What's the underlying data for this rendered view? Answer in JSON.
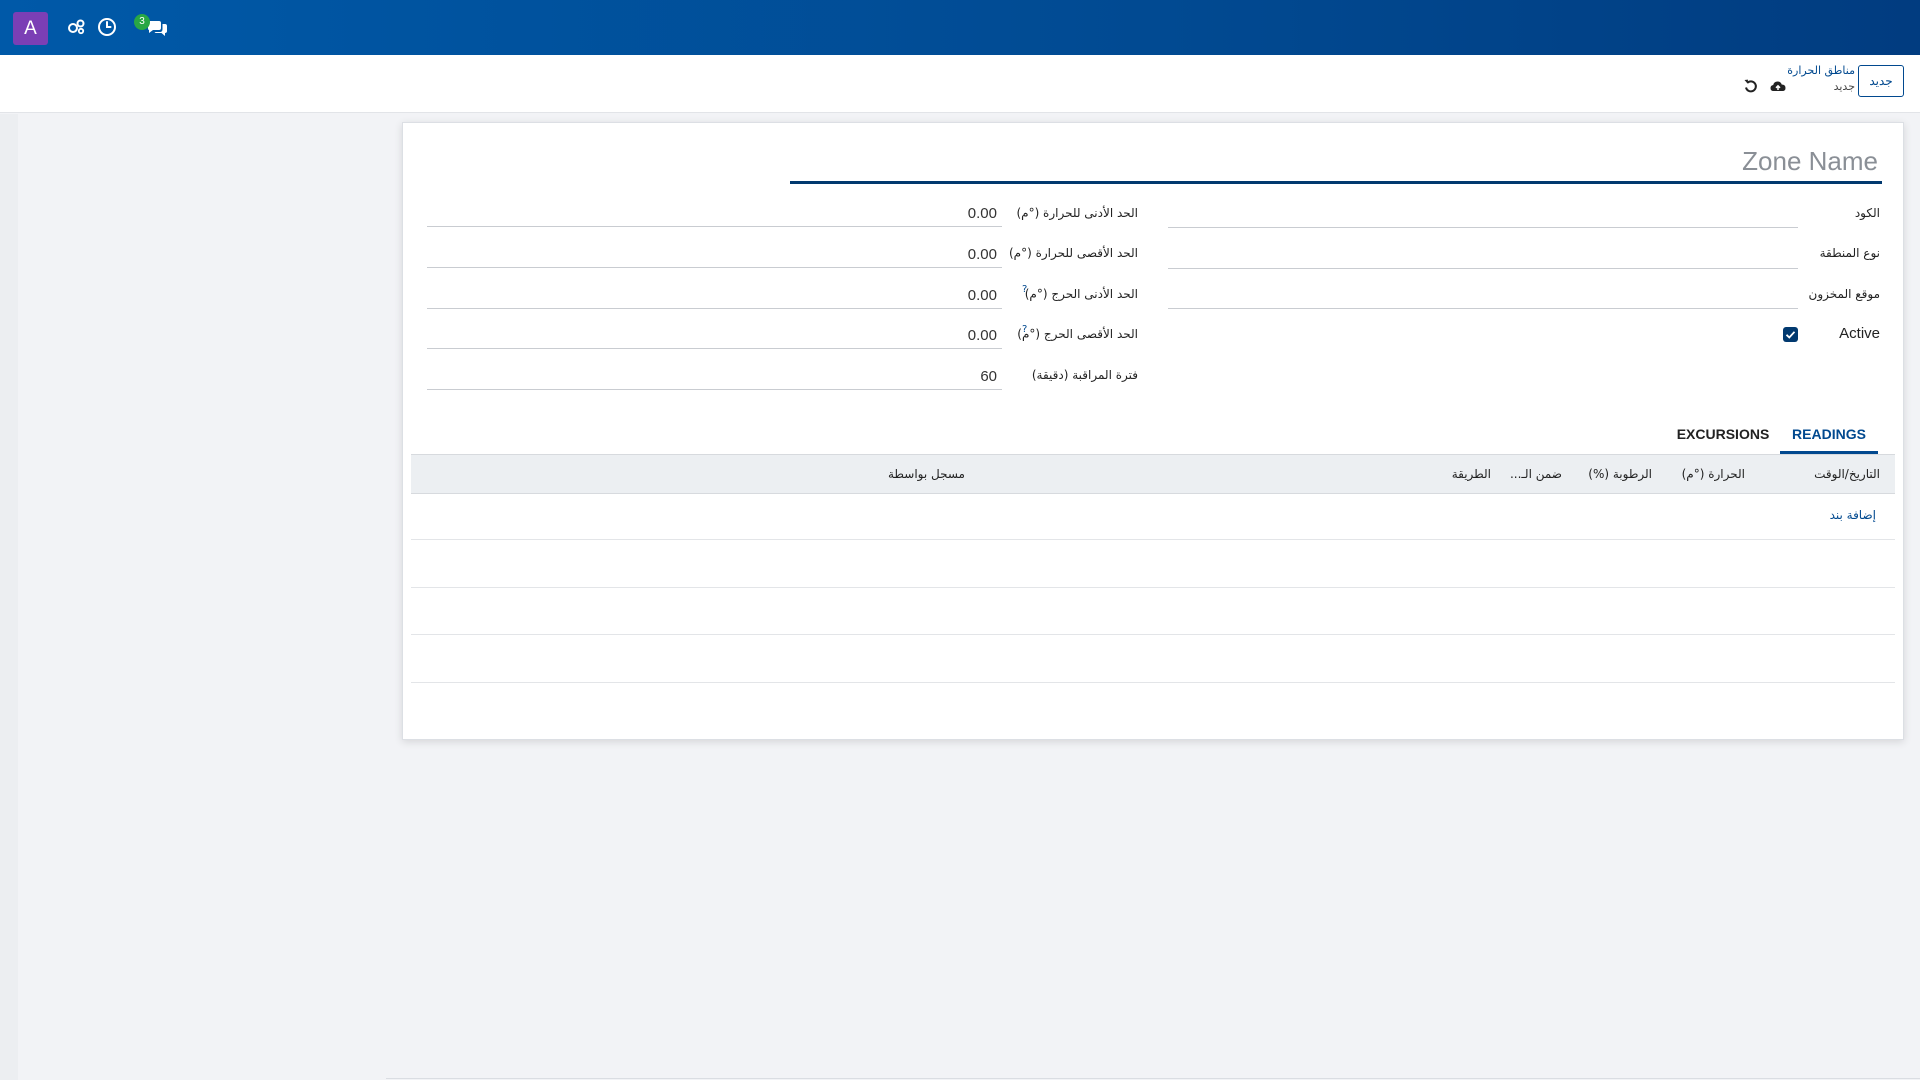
{
  "topbar": {
    "avatar_letter": "A",
    "icons": [
      "activity-icon",
      "clock-icon",
      "chat-icon"
    ],
    "chat_badge": "3",
    "color": "#01498f"
  },
  "control_panel": {
    "new_button": "جديد",
    "breadcrumb_parent": "مناطق الحرارة",
    "breadcrumb_current": "جديد",
    "save_icon": "cloud-upload-icon",
    "discard_icon": "undo-icon"
  },
  "form": {
    "zone_name_placeholder": "Zone Name",
    "fields_right": {
      "code_label": "الكود",
      "code_value": "",
      "zone_type_label": "نوع المنطقة",
      "zone_type_value": "",
      "location_label": "موقع المخزون",
      "location_value": "",
      "active_label": "Active",
      "active_checked": true
    },
    "fields_left": {
      "min_temp_label": "الحد الأدنى للحرارة (°م)",
      "min_temp_value": "0.00",
      "max_temp_label": "الحد الأقصى للحرارة (°م)",
      "max_temp_value": "0.00",
      "critical_min_label": "الحد الأدنى الحرج (°م)",
      "critical_min_value": "0.00",
      "critical_max_label": "الحد الأقصى الحرج (°م)",
      "critical_max_value": "0.00",
      "interval_label": "فترة المراقبة (دقيقة)",
      "interval_value": "60",
      "help_mark": "?"
    }
  },
  "tabs": {
    "readings": "READINGS",
    "excursions": "EXCURSIONS"
  },
  "readings_table": {
    "columns": [
      "التاريخ/الوقت",
      "الحرارة (°م)",
      "الرطوبة (%)",
      "ضمن الـ...",
      "الطريقة",
      "مسجل بواسطة"
    ],
    "add_line": "إضافة بند"
  }
}
